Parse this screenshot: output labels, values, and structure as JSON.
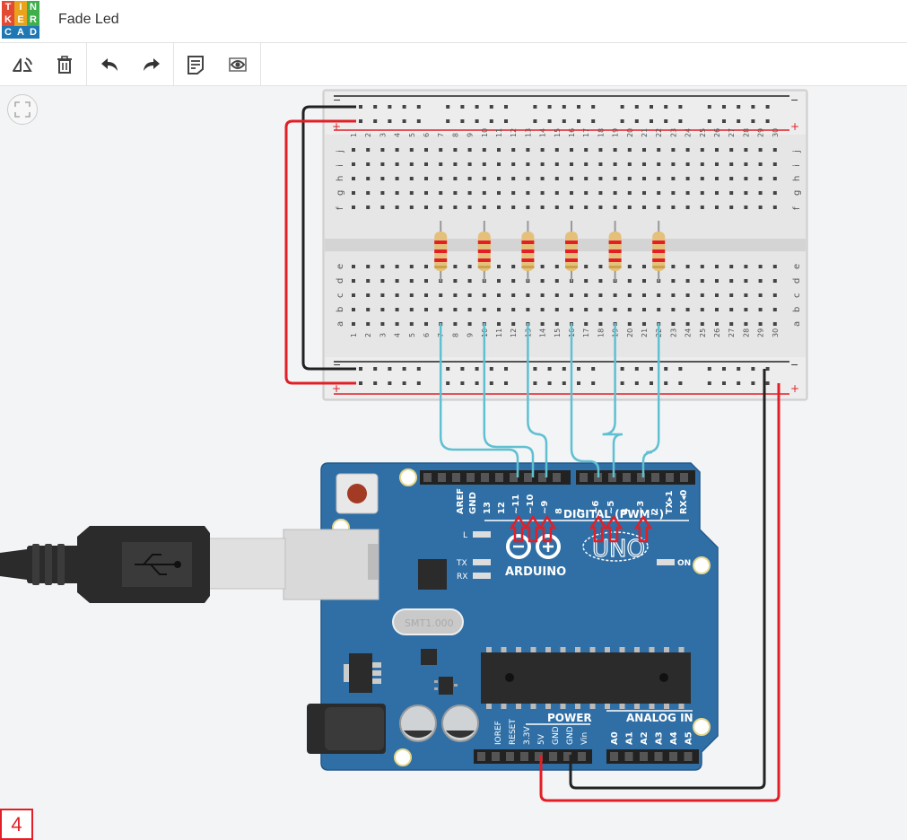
{
  "app": {
    "logo_letters": [
      "T",
      "I",
      "N",
      "K",
      "E",
      "R",
      "C",
      "A",
      "D"
    ],
    "logo_colors": [
      "#e34a33",
      "#e8a21b",
      "#3eaf4a",
      "#e34a33",
      "#e8a21b",
      "#3eaf4a",
      "#1f77b4",
      "#1f77b4",
      "#1f77b4"
    ],
    "title": "Fade Led"
  },
  "toolbar": {
    "items": [
      {
        "name": "rotate-icon",
        "title": "Rotate"
      },
      {
        "name": "trash-icon",
        "title": "Delete"
      },
      {
        "name": "undo-icon",
        "title": "Undo"
      },
      {
        "name": "redo-icon",
        "title": "Redo"
      },
      {
        "name": "notes-icon",
        "title": "Notes"
      },
      {
        "name": "eye-icon",
        "title": "Toggle notes visibility"
      }
    ]
  },
  "breadboard": {
    "column_numbers": [
      "1",
      "2",
      "3",
      "4",
      "5",
      "6",
      "7",
      "8",
      "9",
      "10",
      "11",
      "12",
      "13",
      "14",
      "15",
      "16",
      "17",
      "18",
      "19",
      "20",
      "21",
      "22",
      "23",
      "24",
      "25",
      "26",
      "27",
      "28",
      "29",
      "30"
    ],
    "top_row_letters": [
      "j",
      "i",
      "h",
      "g",
      "f"
    ],
    "bottom_row_letters": [
      "e",
      "d",
      "c",
      "b",
      "a"
    ],
    "rail_plus": "+",
    "rail_minus": "−"
  },
  "arduino": {
    "digital_pins": [
      "AREF",
      "GND",
      "13",
      "12",
      "~11",
      "~10",
      "~9",
      "8",
      "7",
      "~6",
      "~5",
      "4",
      "~3",
      "2",
      "TX▸1",
      "RX◂0"
    ],
    "digital_label": "DIGITAL (PWM~)",
    "brand": "ARDUINO",
    "model": "UNO",
    "led_l": "L",
    "led_tx": "TX",
    "led_rx": "RX",
    "on_label": "ON",
    "crystal": "SMT1.000",
    "power_label": "POWER",
    "power_pins": [
      "IOREF",
      "RESET",
      "3.3V",
      "5V",
      "GND",
      "GND",
      "Vin"
    ],
    "analog_label": "ANALOG IN",
    "analog_pins": [
      "A0",
      "A1",
      "A2",
      "A3",
      "A4",
      "A5"
    ]
  },
  "colors": {
    "wire_red": "#e21f26",
    "wire_black": "#222222",
    "wire_cyan": "#5fc0d2",
    "board_blue": "#2f6fa5",
    "accent_red": "#e21f26"
  },
  "annotation": {
    "step_number": "4"
  }
}
